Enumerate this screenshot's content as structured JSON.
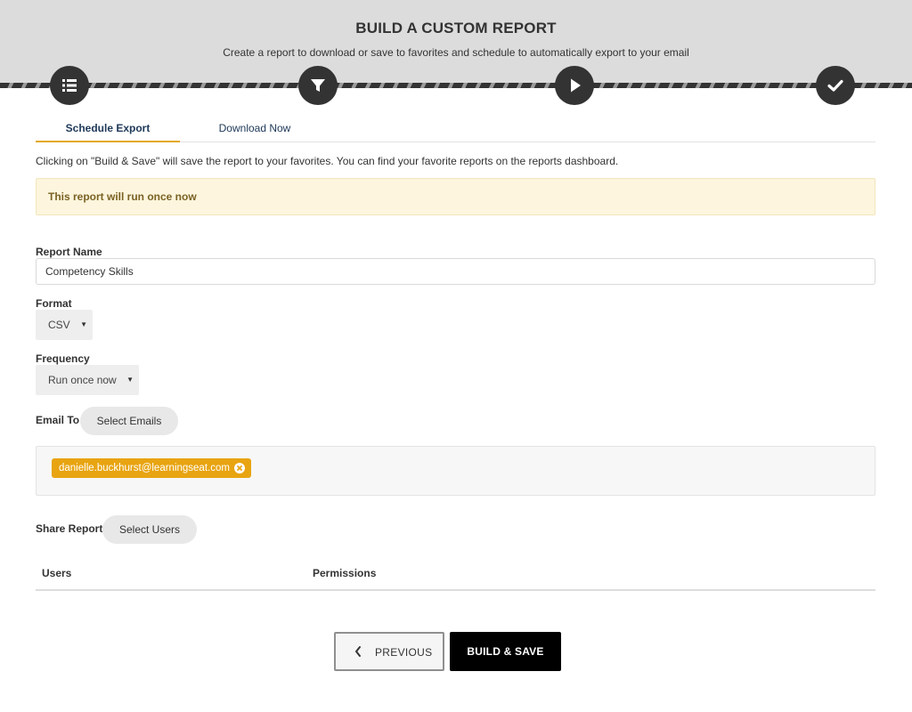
{
  "header": {
    "title": "BUILD A CUSTOM REPORT",
    "subtitle": "Create a report to download or save to favorites and schedule to automatically export to your email"
  },
  "steps": [
    {
      "icon": "list-icon"
    },
    {
      "icon": "filter-icon"
    },
    {
      "icon": "play-icon"
    },
    {
      "icon": "check-icon"
    }
  ],
  "tabs": [
    {
      "label": "Schedule Export",
      "active": true
    },
    {
      "label": "Download Now",
      "active": false
    }
  ],
  "info_text": "Clicking on \"Build & Save\" will save the report to your favorites. You can find your favorite reports on the reports dashboard.",
  "notice": "This report will run once now",
  "form": {
    "report_name_label": "Report Name",
    "report_name_value": "Competency Skills",
    "format_label": "Format",
    "format_value": "CSV",
    "frequency_label": "Frequency",
    "frequency_value": "Run once now",
    "email_to_label": "Email To",
    "select_emails_label": "Select Emails",
    "emails": [
      "danielle.buckhurst@learningseat.com"
    ],
    "share_report_label": "Share Report",
    "select_users_label": "Select Users",
    "users_table": {
      "columns": [
        "Users",
        "Permissions"
      ]
    }
  },
  "actions": {
    "previous_label": "PREVIOUS",
    "build_save_label": "BUILD & SAVE"
  },
  "colors": {
    "accent": "#e8a411",
    "header_bg": "#dcdcdc",
    "notice_bg": "#fdf5dd",
    "primary_button": "#000000"
  }
}
